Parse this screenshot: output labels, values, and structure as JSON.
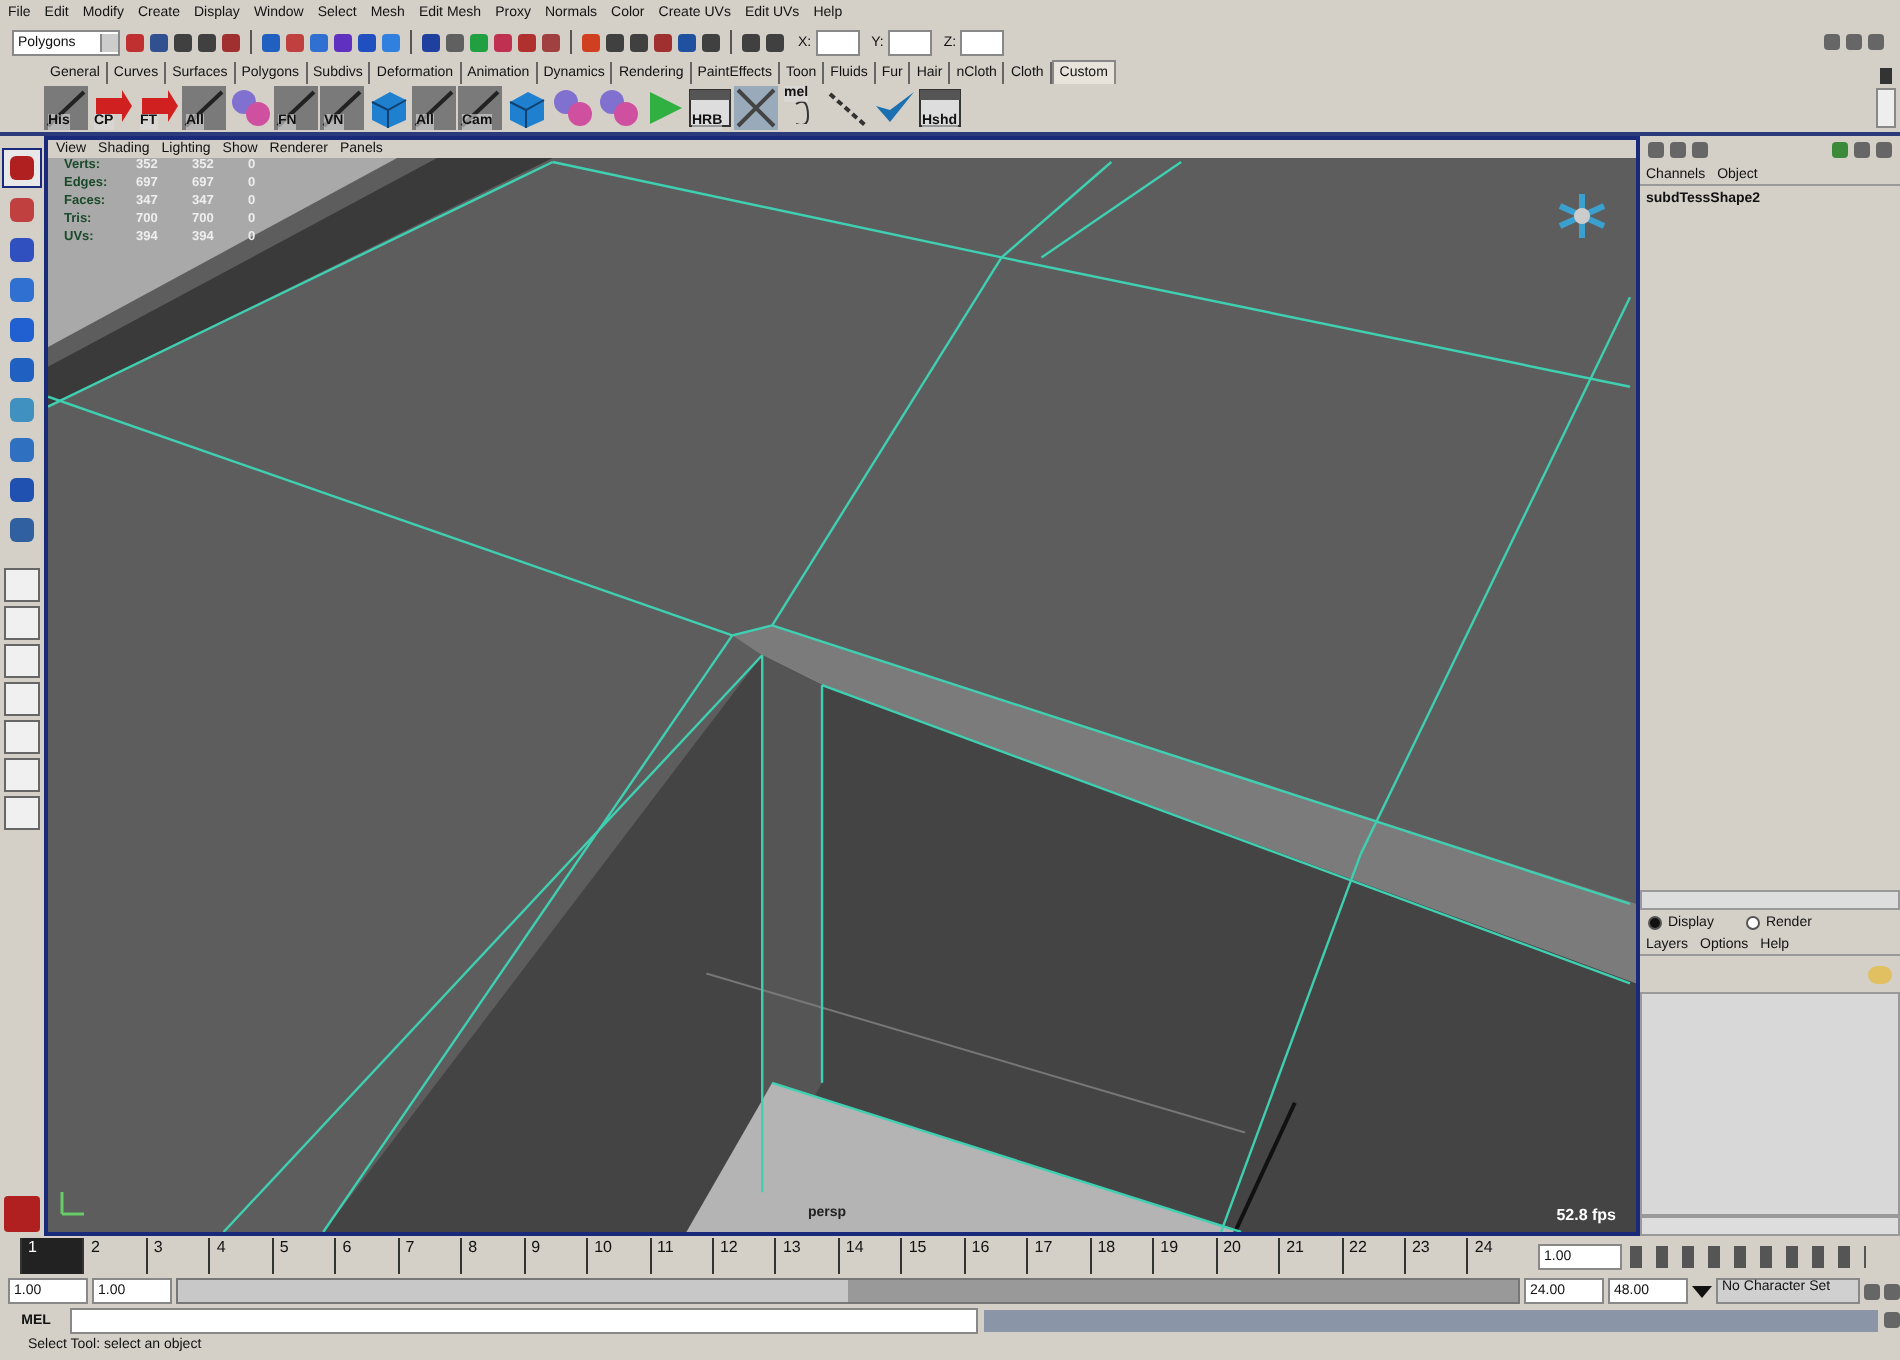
{
  "menu_bar": [
    "File",
    "Edit",
    "Modify",
    "Create",
    "Display",
    "Window",
    "Select",
    "Mesh",
    "Edit Mesh",
    "Proxy",
    "Normals",
    "Color",
    "Create UVs",
    "Edit UVs",
    "Help"
  ],
  "status_line": {
    "mode": "Polygons",
    "coord_labels": [
      "X:",
      "Y:",
      "Z:"
    ]
  },
  "shelf_tabs": [
    {
      "label": "General",
      "selected": false
    },
    {
      "label": "Curves",
      "selected": false
    },
    {
      "label": "Surfaces",
      "selected": false
    },
    {
      "label": "Polygons",
      "selected": false
    },
    {
      "label": "Subdivs",
      "selected": false
    },
    {
      "label": "Deformation",
      "selected": false
    },
    {
      "label": "Animation",
      "selected": false
    },
    {
      "label": "Dynamics",
      "selected": false
    },
    {
      "label": "Rendering",
      "selected": false
    },
    {
      "label": "PaintEffects",
      "selected": false
    },
    {
      "label": "Toon",
      "selected": false
    },
    {
      "label": "Fluids",
      "selected": false
    },
    {
      "label": "Fur",
      "selected": false
    },
    {
      "label": "Hair",
      "selected": false
    },
    {
      "label": "nCloth",
      "selected": false
    },
    {
      "label": "Cloth",
      "selected": false
    },
    {
      "label": "Custom",
      "selected": true
    }
  ],
  "shelf_buttons": [
    {
      "kind": "slash",
      "label": "His"
    },
    {
      "kind": "arrow",
      "label": "CP"
    },
    {
      "kind": "arrow",
      "label": "FT"
    },
    {
      "kind": "slash",
      "label": "All"
    },
    {
      "kind": "spheres"
    },
    {
      "kind": "slash",
      "label": "FN"
    },
    {
      "kind": "slash",
      "label": "VN"
    },
    {
      "kind": "cube"
    },
    {
      "kind": "slash",
      "label": "All"
    },
    {
      "kind": "slash",
      "label": "Cam"
    },
    {
      "kind": "cube"
    },
    {
      "kind": "spheres"
    },
    {
      "kind": "spheres"
    },
    {
      "kind": "play"
    },
    {
      "kind": "panel",
      "label": "HRB"
    },
    {
      "kind": "cross"
    },
    {
      "kind": "script",
      "label": "mel"
    },
    {
      "kind": "chain"
    },
    {
      "kind": "check"
    },
    {
      "kind": "panel",
      "label": "Hshd"
    }
  ],
  "viewport": {
    "menu": [
      "View",
      "Shading",
      "Lighting",
      "Show",
      "Renderer",
      "Panels"
    ],
    "stats": [
      {
        "label": "Verts:",
        "values": [
          "352",
          "352",
          "0"
        ]
      },
      {
        "label": "Edges:",
        "values": [
          "697",
          "697",
          "0"
        ]
      },
      {
        "label": "Faces:",
        "values": [
          "347",
          "347",
          "0"
        ]
      },
      {
        "label": "Tris:",
        "values": [
          "700",
          "700",
          "0"
        ]
      },
      {
        "label": "UVs:",
        "values": [
          "394",
          "394",
          "0"
        ]
      }
    ],
    "camera": "persp",
    "fps": "52.8 fps"
  },
  "channel_box": {
    "menu": [
      "Channels",
      "Object"
    ],
    "object": "subdTessShape2"
  },
  "layer_editor": {
    "modes": [
      {
        "label": "Display",
        "selected": true
      },
      {
        "label": "Render",
        "selected": false
      }
    ],
    "menu": [
      "Layers",
      "Options",
      "Help"
    ]
  },
  "time_slider": {
    "frames": [
      {
        "label": "1",
        "selected": true
      },
      {
        "label": "2",
        "selected": false
      },
      {
        "label": "3",
        "selected": false
      },
      {
        "label": "4",
        "selected": false
      },
      {
        "label": "5",
        "selected": false
      },
      {
        "label": "6",
        "selected": false
      },
      {
        "label": "7",
        "selected": false
      },
      {
        "label": "8",
        "selected": false
      },
      {
        "label": "9",
        "selected": false
      },
      {
        "label": "10",
        "selected": false
      },
      {
        "label": "11",
        "selected": false
      },
      {
        "label": "12",
        "selected": false
      },
      {
        "label": "13",
        "selected": false
      },
      {
        "label": "14",
        "selected": false
      },
      {
        "label": "15",
        "selected": false
      },
      {
        "label": "16",
        "selected": false
      },
      {
        "label": "17",
        "selected": false
      },
      {
        "label": "18",
        "selected": false
      },
      {
        "label": "19",
        "selected": false
      },
      {
        "label": "20",
        "selected": false
      },
      {
        "label": "21",
        "selected": false
      },
      {
        "label": "22",
        "selected": false
      },
      {
        "label": "23",
        "selected": false
      },
      {
        "label": "24",
        "selected": false
      }
    ],
    "current_time": "1.00"
  },
  "range_slider": {
    "level": 0.5,
    "start": "1.00",
    "range_start": "1.00",
    "range_end": "24.00",
    "end": "48.00",
    "character_set": "No Character Set"
  },
  "command_line": {
    "label": "MEL"
  },
  "help_line": "Select Tool: select an object"
}
